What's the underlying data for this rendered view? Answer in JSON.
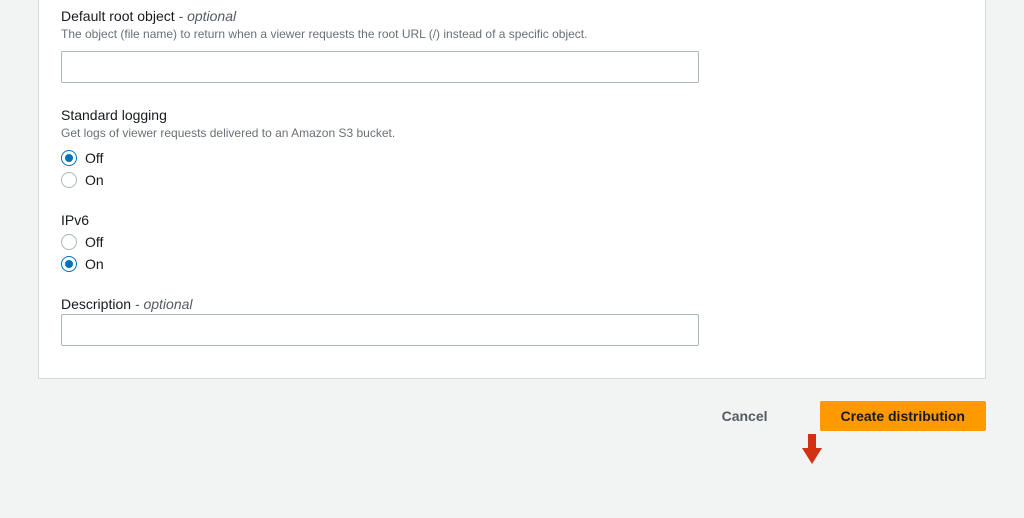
{
  "defaultRoot": {
    "label": "Default root object",
    "optional": "- optional",
    "help": "The object (file name) to return when a viewer requests the root URL (/) instead of a specific object.",
    "value": ""
  },
  "standardLogging": {
    "label": "Standard logging",
    "help": "Get logs of viewer requests delivered to an Amazon S3 bucket.",
    "options": {
      "off": "Off",
      "on": "On"
    },
    "selected": "off"
  },
  "ipv6": {
    "label": "IPv6",
    "options": {
      "off": "Off",
      "on": "On"
    },
    "selected": "on"
  },
  "description": {
    "label": "Description",
    "optional": "- optional",
    "value": ""
  },
  "footer": {
    "cancel": "Cancel",
    "create": "Create distribution"
  }
}
